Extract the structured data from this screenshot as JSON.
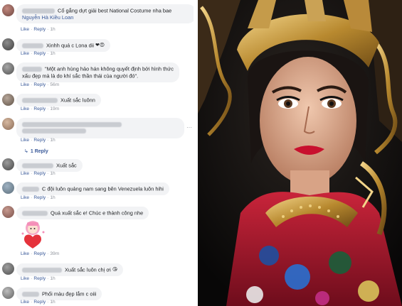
{
  "feed": {
    "actions": {
      "like": "Like",
      "reply": "Reply",
      "separator": "·"
    },
    "comments": [
      {
        "text": "Cố gắng dựt giải best National Costume nha bae",
        "tag": "Nguyễn Hà Kiều Loan",
        "time": "1h"
      },
      {
        "text": "Xinhh quá c Lona dii",
        "emojis": "❤😍",
        "time": "1h"
      },
      {
        "text": "\"Một anh hùng hảo hán không quyết định bởi hình thức xấu đẹp mà là do khí sắc thần thái của người đó\".",
        "time": "56m"
      },
      {
        "text": "Xuất sắc luônn",
        "time": "19m"
      },
      {
        "text": "",
        "time": "1h",
        "replies_label": "1 Reply"
      },
      {
        "text": "Xuất sắc",
        "time": "1h"
      },
      {
        "text": "C đội luôn quảng nam sang bên Venezuela luôn hihi",
        "time": "1h"
      },
      {
        "text": "Quá xuất sắc e! Chúc e thành công nhe",
        "time": "39m"
      },
      {
        "text": "Xuất sắc luôn chị ơi",
        "emojis": "😘",
        "time": "1h"
      },
      {
        "text": "Phối màu đẹp lắm c oiii",
        "time": "1h"
      }
    ],
    "more_icon": "more-options-icon"
  },
  "sticker": {
    "icon": "girl-hugging-heart-sticker"
  },
  "photo": {
    "subject": "portrait-photo"
  },
  "colors": {
    "link": "#385898",
    "bubble": "#f2f3f5",
    "meta": "#90949c"
  }
}
